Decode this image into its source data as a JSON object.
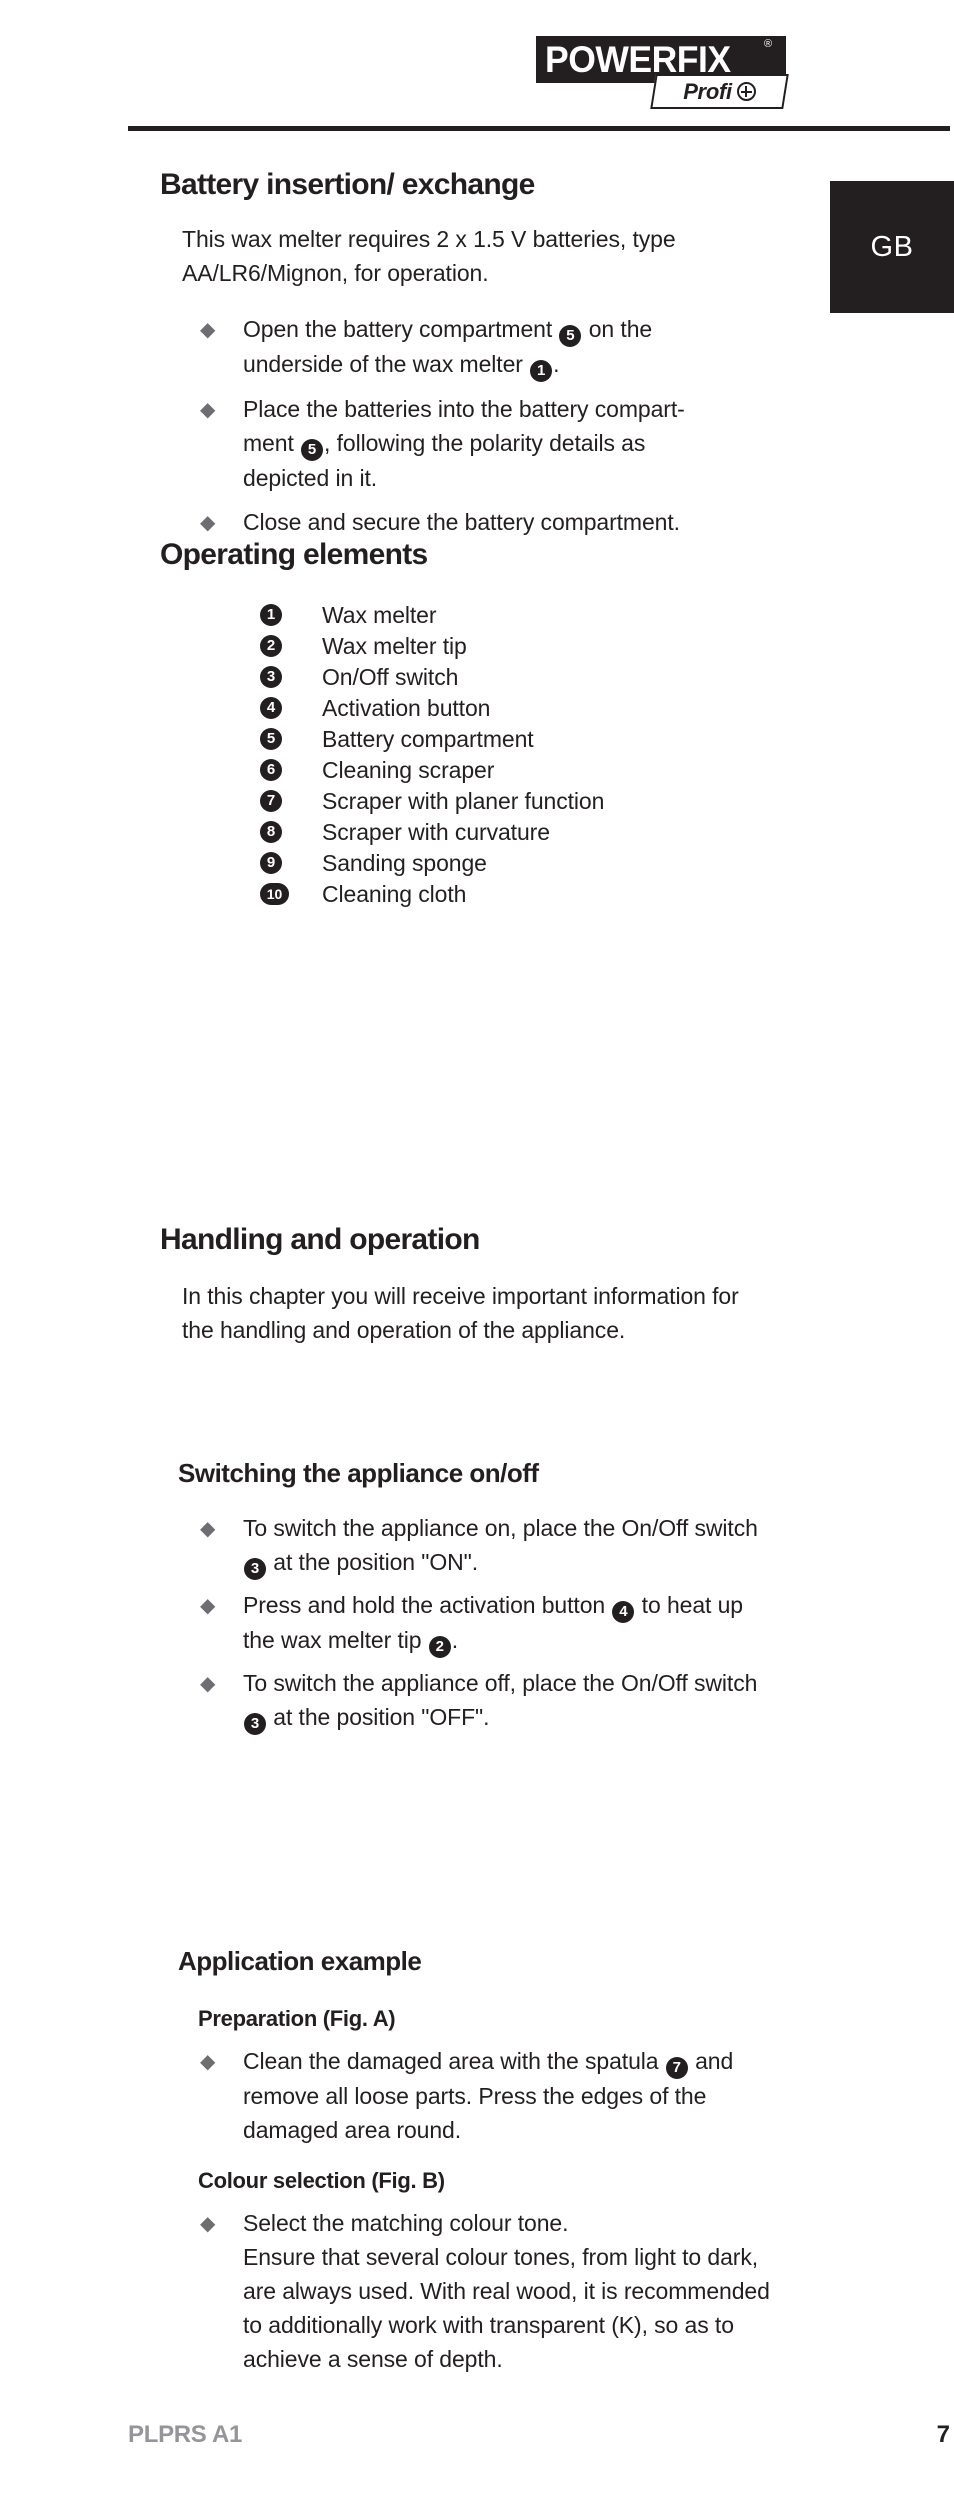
{
  "brand": {
    "logo_word": "POWERFIX",
    "logo_registered": "®",
    "logo_sub": "Profi",
    "logo_plus_icon": "circled-plus-icon"
  },
  "country_tab": {
    "label": "GB"
  },
  "sections": {
    "battery": {
      "title": "Battery insertion/ exchange",
      "intro": "This wax melter requires 2 x 1.5 V batteries, type AA/LR6/Mignon, for operation.",
      "bullets": [
        {
          "parts": [
            {
              "text": "Open the battery compartment "
            },
            {
              "badge": "5"
            },
            {
              "text": " on the underside of the wax melter "
            },
            {
              "badge": "1"
            },
            {
              "text": "."
            }
          ]
        },
        {
          "parts": [
            {
              "text": "Place the batteries into the battery compart-ment "
            },
            {
              "badge": "5"
            },
            {
              "text": ", following the polarity details as depicted in it."
            }
          ]
        },
        {
          "parts": [
            {
              "text": "Close and secure the battery compartment."
            }
          ]
        }
      ]
    },
    "operating_elements": {
      "title": "Operating elements",
      "items": [
        {
          "number": "1",
          "label": "Wax melter"
        },
        {
          "number": "2",
          "label": "Wax melter tip"
        },
        {
          "number": "3",
          "label": "On/Off switch"
        },
        {
          "number": "4",
          "label": "Activation button"
        },
        {
          "number": "5",
          "label": "Battery compartment"
        },
        {
          "number": "6",
          "label": "Cleaning scraper"
        },
        {
          "number": "7",
          "label": "Scraper with planer function"
        },
        {
          "number": "8",
          "label": "Scraper with curvature"
        },
        {
          "number": "9",
          "label": "Sanding sponge"
        },
        {
          "number": "10",
          "label": "Cleaning cloth"
        }
      ]
    },
    "handling": {
      "title": "Handling and operation",
      "intro": "In this chapter you will receive important information for the handling and operation of the appliance."
    },
    "switching": {
      "title": "Switching the appliance on/off",
      "bullets": [
        {
          "parts": [
            {
              "text": "To switch the appliance on, place the On/Off switch "
            },
            {
              "badge": "3"
            },
            {
              "text": " at the position \"ON\"."
            }
          ]
        },
        {
          "parts": [
            {
              "text": "Press and hold the activation button "
            },
            {
              "badge": "4"
            },
            {
              "text": " to heat up the wax melter tip "
            },
            {
              "badge": "2"
            },
            {
              "text": "."
            }
          ]
        },
        {
          "parts": [
            {
              "text": "To switch the appliance off, place the On/Off switch "
            },
            {
              "badge": "3"
            },
            {
              "text": " at the position \"OFF\"."
            }
          ]
        }
      ]
    },
    "application_example": {
      "title": "Application example",
      "preparation": {
        "title": "Preparation (Fig. A)",
        "bullets": [
          {
            "parts": [
              {
                "text": "Clean the damaged area with the spatula "
              },
              {
                "badge": "7"
              },
              {
                "text": " and remove all loose parts. Press the edges of the damaged area round."
              }
            ]
          }
        ]
      },
      "colour_selection": {
        "title": "Colour selection (Fig. B)",
        "bullets": [
          {
            "parts": [
              {
                "text": "Select the matching colour tone.\nEnsure that several colour tones, from light to dark, are always used. With real wood, it is recommended to additionally work with transparent (K), so as to achieve a sense of depth."
              }
            ]
          }
        ]
      }
    }
  },
  "footer": {
    "code": "PLPRS A1",
    "page": "7"
  }
}
